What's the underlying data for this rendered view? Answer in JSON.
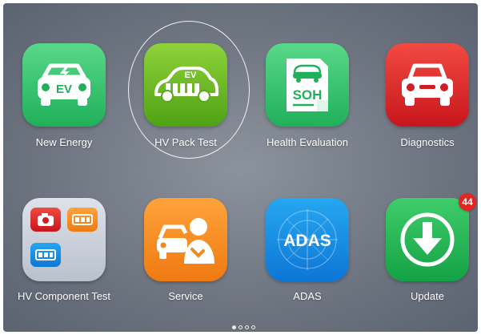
{
  "apps": {
    "new_energy": {
      "label": "New Energy",
      "icon": "ev-car-icon",
      "badge_text": "EV"
    },
    "hv_pack_test": {
      "label": "HV Pack Test",
      "icon": "ev-battery-car-icon",
      "badge_text": "EV"
    },
    "health_evaluation": {
      "label": "Health Evaluation",
      "icon": "soh-document-icon",
      "badge_text": "SOH"
    },
    "diagnostics": {
      "label": "Diagnostics",
      "icon": "car-front-icon"
    },
    "hv_component_test": {
      "label": "HV Component Test",
      "icon": "folder-icon"
    },
    "service": {
      "label": "Service",
      "icon": "car-mechanic-icon"
    },
    "adas": {
      "label": "ADAS",
      "icon": "adas-radar-icon",
      "badge_text": "ADAS"
    },
    "update": {
      "label": "Update",
      "icon": "download-arrow-icon",
      "notification_count": "44"
    }
  },
  "pagination": {
    "pages": 4,
    "current": 1
  },
  "colors": {
    "green": "#1fb05a",
    "lime": "#4fa214",
    "red": "#c8161c",
    "orange": "#ef7a11",
    "blue": "#0d76d6",
    "badge": "#e52521"
  }
}
